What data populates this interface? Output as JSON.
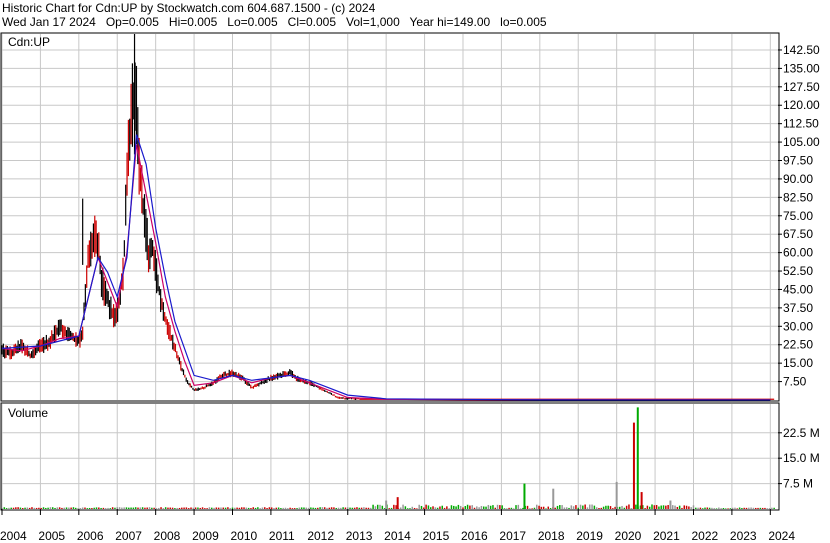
{
  "header": {
    "line1": "Historic Chart for Cdn:UP by Stockwatch.com 604.687.1500 - (c) 2024",
    "line2": "Wed Jan 17 2024   Op=0.005   Hi=0.005   Lo=0.005   Cl=0.005   Vol=1,000   Year hi=149.00   lo=0.005"
  },
  "colors": {
    "up_bar": "#000000",
    "down_bar": "#cc0000",
    "ma_short": "#cc0066",
    "ma_long": "#1a1acc",
    "vol_up": "#00aa00",
    "vol_down": "#cc0000",
    "vol_flat": "#999999",
    "grid": "#c8c8c8"
  },
  "chart_data": [
    {
      "type": "line",
      "title": "Cdn:UP",
      "ylim": [
        0,
        149
      ],
      "y_ticks": [
        "7.50",
        "15.00",
        "22.50",
        "30.00",
        "37.50",
        "45.00",
        "52.50",
        "60.00",
        "67.50",
        "75.00",
        "82.50",
        "90.00",
        "97.50",
        "105.00",
        "112.50",
        "120.00",
        "127.50",
        "135.00",
        "142.50"
      ],
      "x_ticks": [
        "2004",
        "2005",
        "2006",
        "2007",
        "2008",
        "2009",
        "2010",
        "2011",
        "2012",
        "2013",
        "2014",
        "2015",
        "2016",
        "2017",
        "2018",
        "2019",
        "2020",
        "2021",
        "2022",
        "2023",
        "2024"
      ],
      "grid": true,
      "series": [
        {
          "x": [
            2004.0,
            2004.25,
            2004.5,
            2004.75,
            2005.0,
            2005.25,
            2005.5,
            2005.75,
            2006.0,
            2006.1,
            2006.25,
            2006.4,
            2006.5,
            2006.6,
            2006.75,
            2006.9,
            2007.0,
            2007.08,
            2007.17,
            2007.25,
            2007.33,
            2007.42,
            2007.5,
            2007.58,
            2007.67,
            2007.75,
            2007.83,
            2007.92,
            2008.0,
            2008.2,
            2008.4,
            2008.6,
            2008.8,
            2009.0,
            2009.25,
            2009.5,
            2009.75,
            2010.0,
            2010.25,
            2010.5,
            2010.75,
            2011.0,
            2011.25,
            2011.5,
            2011.75,
            2012.0,
            2012.25,
            2012.5,
            2012.75,
            2013.0,
            2014.0,
            2015.0,
            2016.0,
            2017.0,
            2018.0,
            2019.0,
            2020.0,
            2021.0,
            2022.0,
            2023.0,
            2024.0
          ],
          "y": [
            20,
            19,
            22,
            18,
            22,
            24,
            30,
            26,
            24,
            28,
            58,
            66,
            62,
            48,
            40,
            34,
            36,
            42,
            55,
            95,
            110,
            122,
            118,
            92,
            80,
            68,
            58,
            62,
            52,
            36,
            26,
            16,
            8,
            4,
            5,
            7,
            10,
            11,
            9,
            5,
            7,
            9,
            10,
            11,
            8,
            7,
            5,
            3,
            1,
            0.5,
            0.3,
            0.1,
            0.05,
            0.05,
            0.05,
            0.05,
            0.05,
            0.05,
            0.05,
            0.005,
            0.005
          ]
        },
        {
          "x": [
            2004.0,
            2004.5,
            2005.0,
            2005.5,
            2006.0,
            2006.25,
            2006.5,
            2006.75,
            2007.0,
            2007.25,
            2007.5,
            2007.75,
            2008.0,
            2008.25,
            2008.5,
            2008.75,
            2009.0,
            2009.5,
            2010.0,
            2010.5,
            2011.0,
            2011.5,
            2012.0,
            2012.5,
            2013.0,
            2014.0,
            2016.0,
            2018.0,
            2020.0,
            2022.0,
            2024.0
          ],
          "y": [
            21,
            20,
            22,
            25,
            26,
            42,
            58,
            48,
            38,
            60,
            104,
            84,
            64,
            42,
            28,
            16,
            6,
            7,
            10,
            7,
            9,
            10,
            7,
            4,
            1,
            0.3,
            0.1,
            0.05,
            0.05,
            0.05,
            0.005
          ]
        },
        {
          "x": [
            2004.0,
            2005.0,
            2005.5,
            2006.0,
            2006.5,
            2006.75,
            2007.0,
            2007.25,
            2007.5,
            2007.75,
            2008.0,
            2008.25,
            2008.5,
            2009.0,
            2009.5,
            2010.0,
            2010.5,
            2011.0,
            2011.5,
            2012.0,
            2012.5,
            2013.0,
            2014.0,
            2018.0,
            2024.0
          ],
          "y": [
            21,
            22,
            24,
            26,
            58,
            52,
            42,
            58,
            108,
            96,
            70,
            50,
            32,
            10,
            8,
            10,
            8,
            9,
            10,
            8,
            5,
            2,
            0.5,
            0.05,
            0.005
          ]
        }
      ]
    },
    {
      "type": "bar",
      "title": "Volume",
      "ylim": [
        0,
        31
      ],
      "y_ticks": [
        "7.5 M",
        "15.0 M",
        "22.5 M"
      ],
      "notable_values_millions": [
        {
          "x": 2014.0,
          "value": 2.5
        },
        {
          "x": 2014.3,
          "value": 3.5
        },
        {
          "x": 2017.6,
          "value": 7.5
        },
        {
          "x": 2018.35,
          "value": 6.0
        },
        {
          "x": 2020.0,
          "value": 8.0
        },
        {
          "x": 2020.45,
          "value": 25.5
        },
        {
          "x": 2020.55,
          "value": 30.0
        },
        {
          "x": 2020.65,
          "value": 5.0
        },
        {
          "x": 2021.4,
          "value": 2.5
        }
      ]
    }
  ],
  "volume_panel": {
    "label": "Volume"
  },
  "price_panel": {
    "label": "Cdn:UP"
  }
}
